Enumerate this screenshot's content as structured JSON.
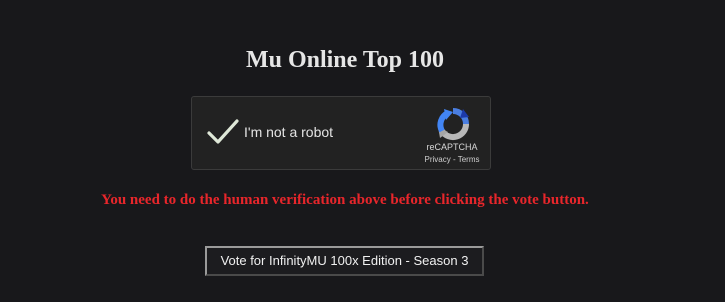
{
  "page": {
    "title": "Mu Online Top 100",
    "background_color": "#18181b"
  },
  "captcha": {
    "label": "I'm not a robot",
    "checked": true,
    "check_icon": "checkmark-icon",
    "logo_icon": "recaptcha-logo-icon",
    "brand": "reCAPTCHA",
    "privacy_link": "Privacy",
    "separator": " - ",
    "terms_link": "Terms"
  },
  "warning": {
    "text": "You need to do the human verification above before clicking the vote button.",
    "color": "#e8262b"
  },
  "vote": {
    "button_label": "Vote for InfinityMU 100x Edition - Season 3"
  }
}
